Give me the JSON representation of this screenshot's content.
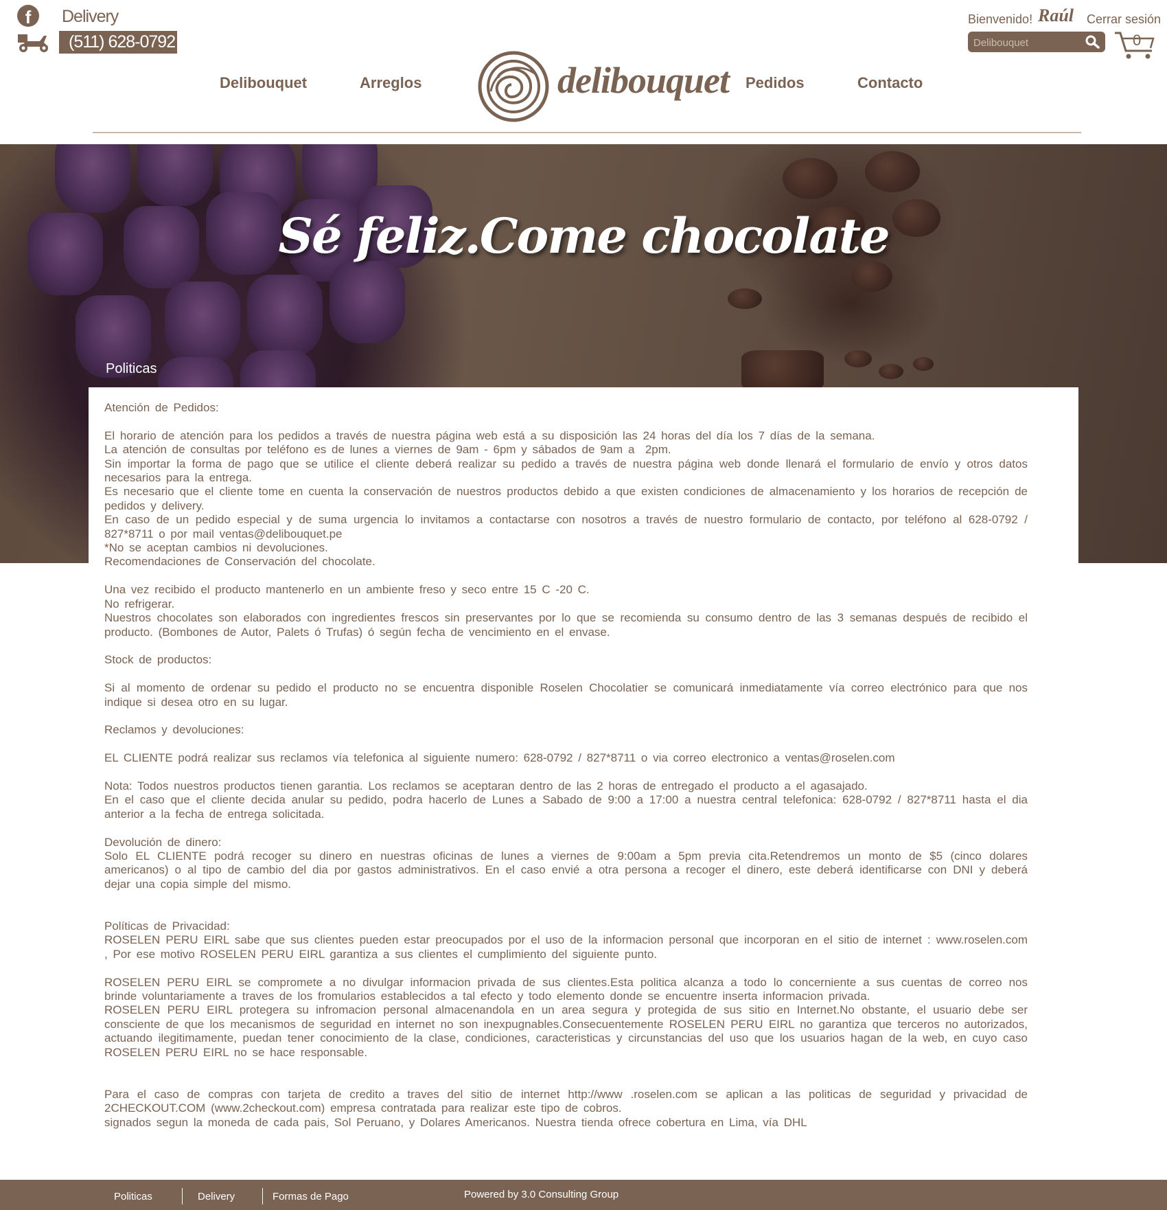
{
  "header": {
    "delivery_label": "Delivery",
    "phone": "(511) 628-0792",
    "welcome": "Bienvenido!",
    "username": "Raúl",
    "logout": "Cerrar sesión",
    "search_placeholder": "Delibouquet",
    "cart_count": "0"
  },
  "nav": {
    "items": [
      "Delibouquet",
      "Arreglos",
      "Pedidos",
      "Contacto"
    ],
    "logo_text": "delibouquet"
  },
  "hero": {
    "title": "Sé feliz.Come chocolate",
    "section_label": "Politicas"
  },
  "content": {
    "text": "Atención de Pedidos:\n\nEl horario de atención para los pedidos a través de nuestra página web está a su disposición las 24 horas del día los 7 días de la semana.\nLa atención de consultas por teléfono es de lunes a viernes de 9am - 6pm y sábados de 9am a  2pm.\nSin importar la forma de pago que se utilice el cliente deberá realizar su pedido a través de nuestra página web donde llenará el formulario de envío y otros datos necesarios para la entrega.\nEs necesario que el cliente tome en cuenta la conservación de nuestros productos debido a que existen condiciones de almacenamiento y los horarios de recepción de pedidos y delivery.\nEn caso de un pedido especial y de suma urgencia lo invitamos a contactarse con nosotros a través de nuestro formulario de contacto, por teléfono al 628-0792 / 827*8711 o por mail ventas@delibouquet.pe\n*No se aceptan cambios ni devoluciones.\nRecomendaciones de Conservación del chocolate.\n\nUna vez recibido el producto mantenerlo en un ambiente freso y seco entre 15 C -20 C.\nNo refrigerar.\nNuestros chocolates son elaborados con ingredientes frescos sin preservantes por lo que se recomienda su consumo dentro de las 3 semanas después de recibido el producto. (Bombones de Autor, Palets ó Trufas) ó según fecha de vencimiento en el envase.\n\nStock de productos:\n\nSi al momento de ordenar su pedido el producto no se encuentra disponible Roselen Chocolatier se comunicará inmediatamente vía correo electrónico para que nos indique si desea otro en su lugar.\n\nReclamos y devoluciones:\n\nEL CLIENTE podrá realizar sus reclamos vía telefonica al siguiente numero: 628-0792 / 827*8711 o via correo electronico a ventas@roselen.com\n\nNota: Todos nuestros productos tienen garantia. Los reclamos se aceptaran dentro de las 2 horas de entregado el producto a el agasajado.\nEn el caso que el cliente decida anular su pedido, podra hacerlo de Lunes a Sabado de 9:00 a 17:00 a nuestra central telefonica: 628-0792 / 827*8711 hasta el dia anterior a la fecha de entrega solicitada.\n\nDevolución de dinero:\nSolo EL CLIENTE podrá recoger su dinero en nuestras oficinas de lunes a viernes de 9:00am a 5pm previa cita.Retendremos un monto de $5 (cinco dolares americanos) o al tipo de cambio del dia por gastos administrativos. En el caso envié a otra persona a recoger el dinero, este deberá identificarse con DNI y deberá dejar una copia simple del mismo.\n\n\nPolíticas de Privacidad:\nROSELEN PERU EIRL sabe que sus clientes pueden estar preocupados por el uso de la informacion personal que incorporan en el sitio de internet : www.roselen.com , Por ese motivo ROSELEN PERU EIRL garantiza a sus clientes el cumplimiento del siguiente punto.\n\nROSELEN PERU EIRL se compromete a no divulgar informacion privada de sus clientes.Esta politica alcanza a todo lo concerniente a sus cuentas de correo nos brinde voluntariamente a traves de los fromularios establecidos a tal efecto y todo elemento donde se encuentre inserta informacion privada.\nROSELEN PERU EIRL protegera su infromacion personal almacenandola en un area segura y protegida de sus sitio en Internet.No obstante, el usuario debe ser consciente de que los mecanismos de seguridad en internet no son inexpugnables.Consecuentemente ROSELEN PERU EIRL no garantiza que terceros no autorizados, actuando ilegitimamente, puedan tener conocimiento de la clase, condiciones, caracteristicas y circunstancias del uso que los usuarios hagan de la web, en cuyo caso ROSELEN PERU EIRL no se hace responsable.\n\n\nPara el caso de compras con tarjeta de credito a traves del sitio de internet http://www .roselen.com se aplican a las politicas de seguridad y privacidad de 2CHECKOUT.COM (www.2checkout.com) empresa contratada para realizar este tipo de cobros.\nsignados segun la moneda de cada pais, Sol Peruano, y Dolares Americanos. Nuestra tienda ofrece cobertura en Lima, vía DHL"
  },
  "footer": {
    "links": [
      "Politicas",
      "Delivery",
      "Formas de Pago"
    ],
    "powered": "Powered by 3.0 Consulting Group"
  },
  "colors": {
    "brand": "#7a6353",
    "footer_bg": "#7a6353",
    "rule": "#c9b8aa"
  },
  "icons": [
    "facebook-icon",
    "delivery-scooter-icon",
    "search-icon",
    "cart-icon"
  ]
}
